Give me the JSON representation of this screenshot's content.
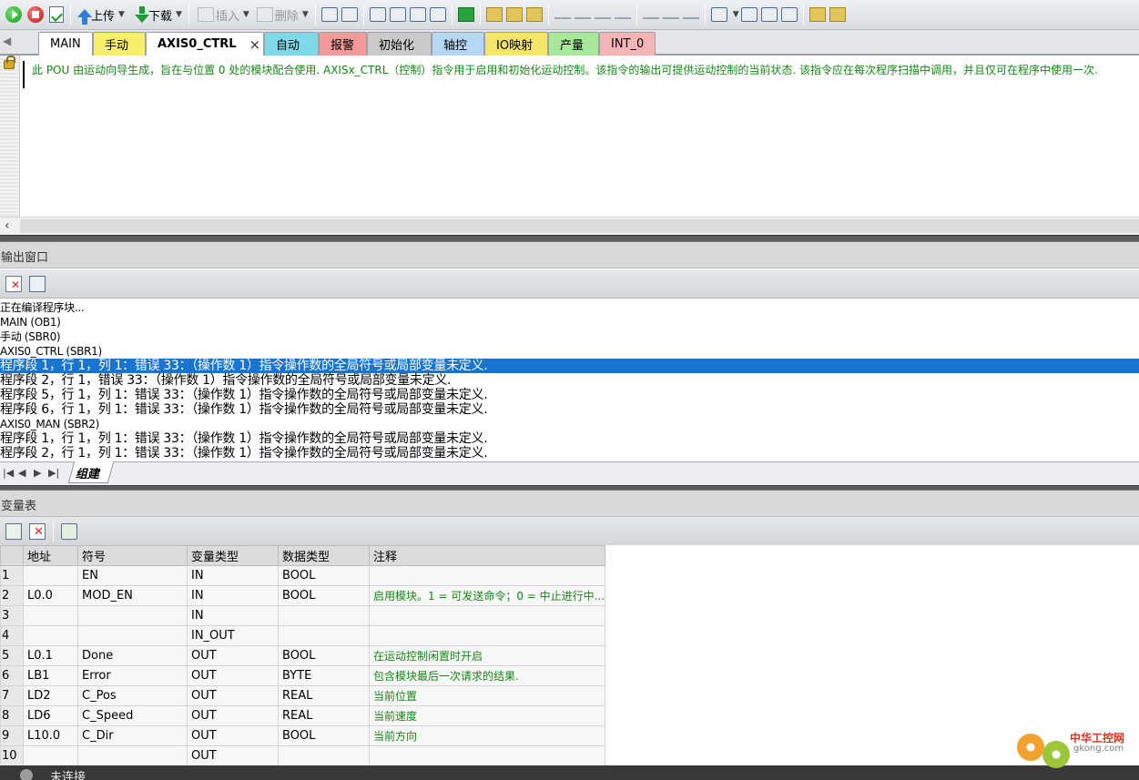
{
  "toolbar": {
    "upload_label": "上传",
    "download_label": "下载",
    "insert_label": "插入",
    "delete_label": "删除"
  },
  "tabs": [
    {
      "label": "MAIN",
      "color": "#ffffff"
    },
    {
      "label": "手动",
      "color": "#f7ef6b"
    },
    {
      "label": "AXIS0_CTRL",
      "color": "#ffffff",
      "active": true
    },
    {
      "label": "自动",
      "color": "#7fd9e8"
    },
    {
      "label": "报警",
      "color": "#f29a9a"
    },
    {
      "label": "初始化",
      "color": "#c9c9c9"
    },
    {
      "label": "轴控",
      "color": "#b6d8f5"
    },
    {
      "label": "IO映射",
      "color": "#f5e56b"
    },
    {
      "label": "产量",
      "color": "#a8e89a"
    },
    {
      "label": "INT_0",
      "color": "#f5b5b5"
    }
  ],
  "tab_close_glyph": "×",
  "editor": {
    "comment": "此 POU 由运动向导生成，旨在与位置 0 处的模块配合使用. AXISx_CTRL（控制）指令用于启用和初始化运动控制。该指令的输出可提供运动控制的当前状态. 该指令应在每次程序扫描中调用，并且仅可在程序中使用一次."
  },
  "output_panel": {
    "title": "输出窗口",
    "lines": [
      {
        "text": "正在编译程序块...",
        "small": true
      },
      {
        "text": "MAIN (OB1)",
        "small": true
      },
      {
        "text": "手动 (SBR0)",
        "small": true
      },
      {
        "text": "AXIS0_CTRL (SBR1)",
        "small": true
      },
      {
        "text": "程序段 1，行 1，列 1：错误 33：（操作数 1）指令操作数的全局符号或局部变量未定义.",
        "selected": true
      },
      {
        "text": "程序段 2，行 1，错误 33：（操作数 1）指令操作数的全局符号或局部变量未定义."
      },
      {
        "text": "程序段 5，行 1，列 1：错误 33：（操作数 1）指令操作数的全局符号或局部变量未定义."
      },
      {
        "text": "程序段 6，行 1，列 1：错误 33：（操作数 1）指令操作数的全局符号或局部变量未定义."
      },
      {
        "text": "AXIS0_MAN (SBR2)",
        "small": true
      },
      {
        "text": "程序段 1，行 1，列 1：错误 33：（操作数 1）指令操作数的全局符号或局部变量未定义."
      },
      {
        "text": "程序段 2，行 1，列 1：错误 33：（操作数 1）指令操作数的全局符号或局部变量未定义."
      }
    ],
    "tab_label": "组建"
  },
  "var_table": {
    "title": "变量表",
    "columns": [
      "",
      "地址",
      "符号",
      "变量类型",
      "数据类型",
      "注释"
    ],
    "rows": [
      [
        "1",
        "",
        "EN",
        "IN",
        "BOOL",
        ""
      ],
      [
        "2",
        "L0.0",
        "MOD_EN",
        "IN",
        "BOOL",
        "启用模块。1 = 可发送命令；0 = 中止进行中..."
      ],
      [
        "3",
        "",
        "",
        "IN",
        "",
        ""
      ],
      [
        "4",
        "",
        "",
        "IN_OUT",
        "",
        ""
      ],
      [
        "5",
        "L0.1",
        "Done",
        "OUT",
        "BOOL",
        "在运动控制闲置时开启"
      ],
      [
        "6",
        "LB1",
        "Error",
        "OUT",
        "BYTE",
        "包含模块最后一次请求的结果."
      ],
      [
        "7",
        "LD2",
        "C_Pos",
        "OUT",
        "REAL",
        "当前位置"
      ],
      [
        "8",
        "LD6",
        "C_Speed",
        "OUT",
        "REAL",
        "当前速度"
      ],
      [
        "9",
        "L10.0",
        "C_Dir",
        "OUT",
        "BOOL",
        "当前方向"
      ],
      [
        "10",
        "",
        "",
        "OUT",
        "",
        ""
      ]
    ]
  },
  "status": {
    "text": "未连接"
  },
  "watermark": {
    "text": "中华工控网",
    "sub": "gkong.com"
  }
}
